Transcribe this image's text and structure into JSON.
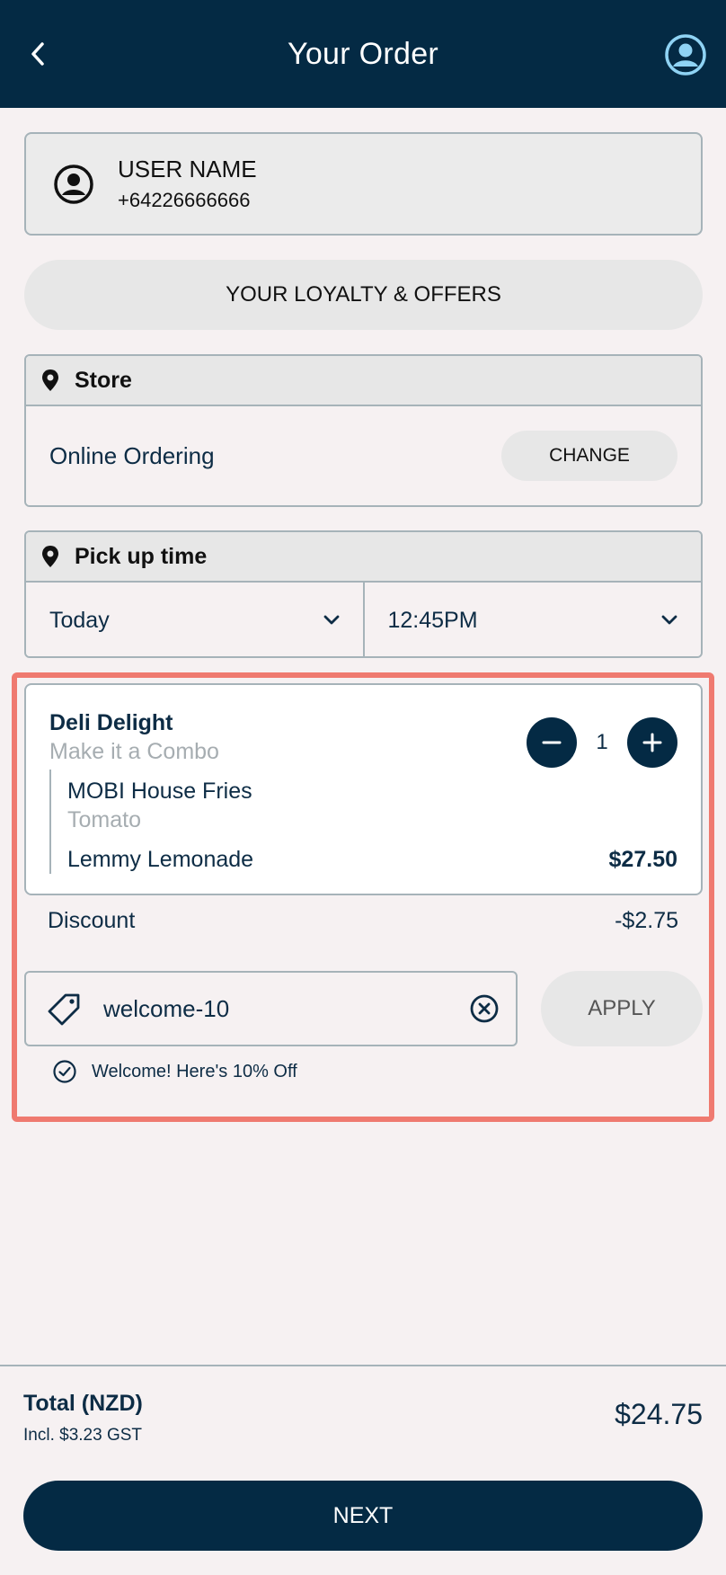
{
  "header": {
    "title": "Your Order",
    "back_icon": "chevron-left-icon",
    "profile_icon": "user-circle-icon"
  },
  "user": {
    "name": "USER NAME",
    "phone": "+64226666666"
  },
  "loyalty": {
    "label": "YOUR LOYALTY & OFFERS"
  },
  "store": {
    "heading": "Store",
    "name": "Online Ordering",
    "change_label": "CHANGE"
  },
  "pickup": {
    "heading": "Pick up time",
    "day": "Today",
    "time": "12:45PM"
  },
  "item": {
    "title": "Deli Delight",
    "subtitle": "Make it a Combo",
    "modifier1": "MOBI House Fries",
    "modifier1_sub": "Tomato",
    "modifier2": "Lemmy Lemonade",
    "price": "$27.50",
    "quantity": "1"
  },
  "discount": {
    "label": "Discount",
    "amount": "-$2.75"
  },
  "promo": {
    "code": "welcome-10",
    "apply_label": "APPLY",
    "message": "Welcome! Here's 10% Off"
  },
  "totals": {
    "label": "Total (NZD)",
    "gst": "Incl. $3.23 GST",
    "value": "$24.75"
  },
  "next_label": "NEXT",
  "colors": {
    "primary": "#042a44",
    "highlight": "#ef7a70",
    "background": "#f6f1f2"
  }
}
